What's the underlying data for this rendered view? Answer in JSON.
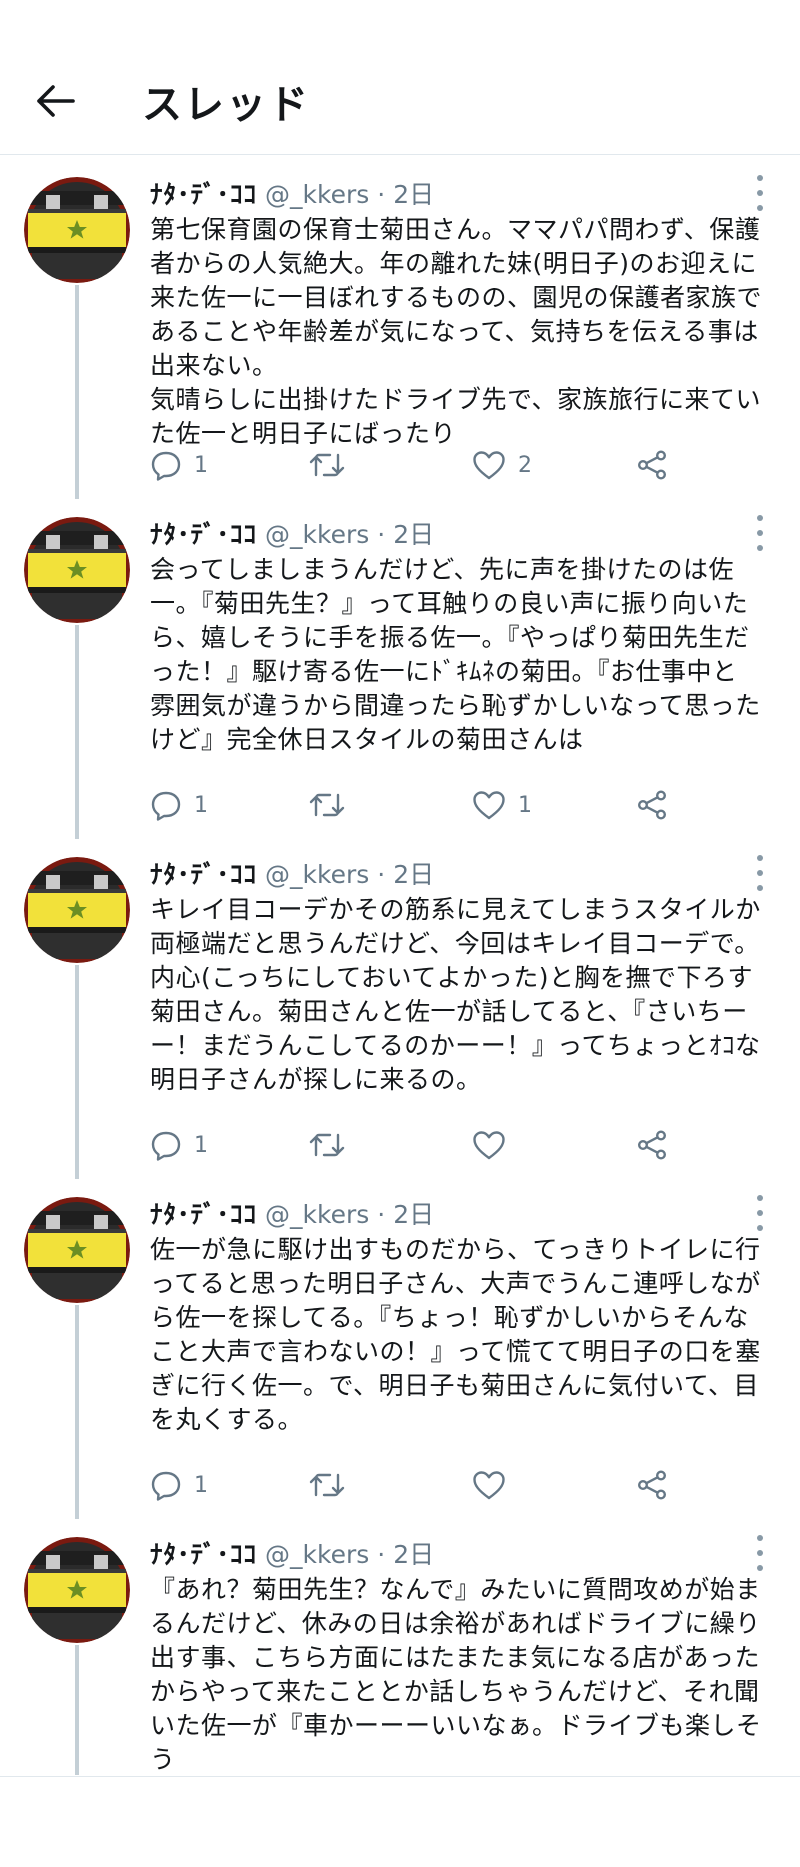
{
  "header": {
    "title": "スレッド"
  },
  "colors": {
    "text": "#14171a",
    "secondary": "#657786",
    "icon": "#657786",
    "thread_line": "#c4cfd6",
    "avatar_ring": "#7a1a10",
    "avatar_yellow": "#f2e13a",
    "avatar_dark": "#2b2b2b"
  },
  "icons": {
    "back": "arrow-left-icon",
    "reply": "reply-icon",
    "retweet": "retweet-icon",
    "like": "heart-icon",
    "share": "share-icon",
    "more": "more-vertical-icon"
  },
  "tweets": [
    {
      "display_name": "ﾅﾀ･ﾃﾞ･ｺｺ",
      "handle": "@_kkers",
      "separator": "·",
      "time": "2日",
      "text": "第七保育園の保育士菊田さん。ママパパ問わず、保護\n者からの人気絶大。年の離れた妹(明日子)のお迎えに\n来た佐一に一目ぼれするものの、園児の保護者家族で\nあることや年齢差が気になって、気持ちを伝える事は\n出来ない。\n気晴らしに出掛けたドライブ先で、家族旅行に来てい\nた佐一と明日子にばったり",
      "reply_count": "1",
      "retweet_count": "",
      "like_count": "2"
    },
    {
      "display_name": "ﾅﾀ･ﾃﾞ･ｺｺ",
      "handle": "@_kkers",
      "separator": "·",
      "time": "2日",
      "text": "会ってしましまうんだけど、先に声を掛けたのは佐\n一。『菊田先生？』って耳触りの良い声に振り向いた\nら、嬉しそうに手を振る佐一。『やっぱり菊田先生だ\nった！』駆け寄る佐一にﾄﾞｷﾑﾈの菊田。『お仕事中と\n雰囲気が違うから間違ったら恥ずかしいなって思った\nけど』完全休日スタイルの菊田さんは",
      "reply_count": "1",
      "retweet_count": "",
      "like_count": "1"
    },
    {
      "display_name": "ﾅﾀ･ﾃﾞ･ｺｺ",
      "handle": "@_kkers",
      "separator": "·",
      "time": "2日",
      "text": "キレイ目コーデかその筋系に見えてしまうスタイルか\n両極端だと思うんだけど、今回はキレイ目コーデで。\n内心(こっちにしておいてよかった)と胸を撫で下ろす\n菊田さん。菊田さんと佐一が話してると、『さいちー\nー！まだうんこしてるのかーー！』ってちょっとｵｺな\n明日子さんが探しに来るの。",
      "reply_count": "1",
      "retweet_count": "",
      "like_count": ""
    },
    {
      "display_name": "ﾅﾀ･ﾃﾞ･ｺｺ",
      "handle": "@_kkers",
      "separator": "·",
      "time": "2日",
      "text": "佐一が急に駆け出すものだから、てっきりトイレに行\nってると思った明日子さん、大声でうんこ連呼しなが\nら佐一を探してる。『ちょっ！恥ずかしいからそんな\nこと大声で言わないの！』って慌てて明日子の口を塞\nぎに行く佐一。で、明日子も菊田さんに気付いて、目\nを丸くする。",
      "reply_count": "1",
      "retweet_count": "",
      "like_count": ""
    },
    {
      "display_name": "ﾅﾀ･ﾃﾞ･ｺｺ",
      "handle": "@_kkers",
      "separator": "·",
      "time": "2日",
      "text": "『あれ？菊田先生？なんで』みたいに質問攻めが始ま\nるんだけど、休みの日は余裕があればドライブに繰り\n出す事、こちら方面にはたまたま気になる店があった\nからやって来たこととか話しちゃうんだけど、それ聞\nいた佐一が『車かーーーいいなぁ。ドライブも楽しそう",
      "reply_count": "",
      "retweet_count": "",
      "like_count": ""
    }
  ]
}
